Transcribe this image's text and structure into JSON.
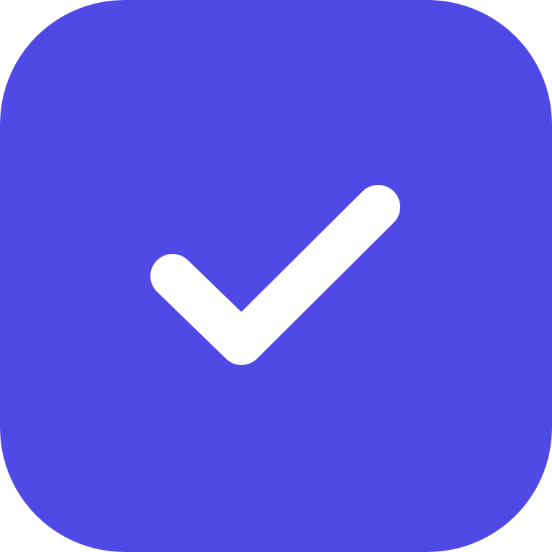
{
  "icon": {
    "name": "checkmark-icon",
    "background_color": "#4F4AE6",
    "glyph_color": "#FFFFFF",
    "state": "checked"
  }
}
